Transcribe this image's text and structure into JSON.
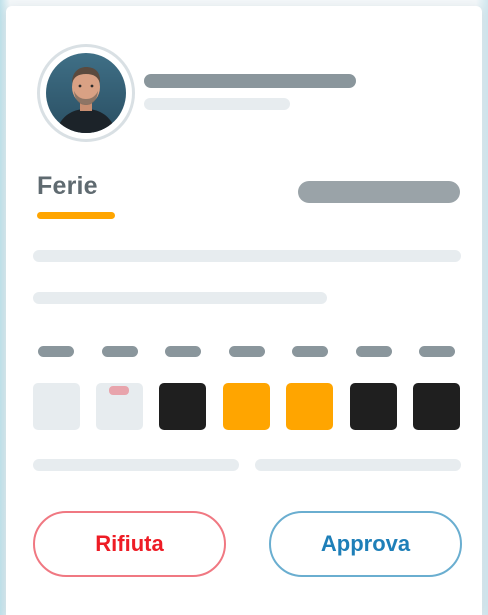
{
  "colors": {
    "accent_orange": "#ffa500",
    "reject_red": "#ee1c25",
    "approve_blue": "#1e7fb8",
    "dark_day": "#1f1f1f",
    "empty_day": "#e7ecef",
    "skeleton_dark": "#8a969c",
    "skeleton_light": "#e7ecef"
  },
  "request": {
    "type_label": "Ferie"
  },
  "week": {
    "days": [
      {
        "state": "empty",
        "marked": false
      },
      {
        "state": "empty",
        "marked": true
      },
      {
        "state": "booked",
        "marked": false
      },
      {
        "state": "selected",
        "marked": false
      },
      {
        "state": "selected",
        "marked": false
      },
      {
        "state": "booked",
        "marked": false
      },
      {
        "state": "booked",
        "marked": false
      }
    ]
  },
  "actions": {
    "reject_label": "Rifiuta",
    "approve_label": "Approva"
  },
  "icons": {
    "avatar": "user-avatar-icon"
  }
}
